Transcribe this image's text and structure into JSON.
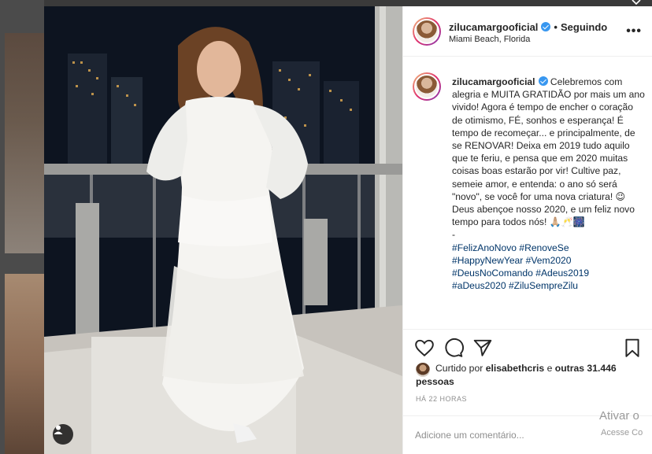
{
  "post": {
    "username": "zilucamargooficial",
    "follow_status": "Seguindo",
    "location": "Miami Beach, Florida",
    "more_label": "•••",
    "caption_paragraphs": [
      "Celebremos com alegria e MUITA GRATIDÃO por mais um ano vivido! Agora é tempo de encher o coração de otimismo, FÉ, sonhos e esperança! É tempo de recomeçar... e principalmente, de se RENOVAR! Deixa em 2019 tudo aquilo que te feriu, e pensa que em 2020 muitas coisas boas estarão por vir! Cultive paz, semeie amor, e entenda: o ano só será \"novo\", se você for uma nova criatura! 😉",
      "Deus abençoe nosso 2020, e um feliz novo tempo para todos nós! 🙏🏼🥂🎆",
      "-"
    ],
    "hashtags": [
      "#FelizAnoNovo #RenoveSe",
      "#HappyNewYear #Vem2020",
      "#DeusNoComando #Adeus2019",
      "#aDeus2020 #ZiluSempreZilu"
    ],
    "liked_by_prefix": "Curtido por",
    "liked_by_user": "elisabethcris",
    "liked_by_connector": "e",
    "liked_by_others": "outras 31.446 pessoas",
    "timestamp": "HÁ 22 HORAS",
    "comment_placeholder": "Adicione um comentário..."
  },
  "icons": [
    "heart-icon",
    "comment-icon",
    "share-icon",
    "bookmark-icon",
    "user-tag-icon",
    "verified-badge-icon",
    "close-icon"
  ],
  "overlay": {
    "activate_title": "Ativar o",
    "activate_sub": "Acesse Co"
  },
  "colors": {
    "hashtag": "#003569",
    "verified": "#3897f0",
    "muted": "#8e8e8e",
    "text": "#262626"
  }
}
